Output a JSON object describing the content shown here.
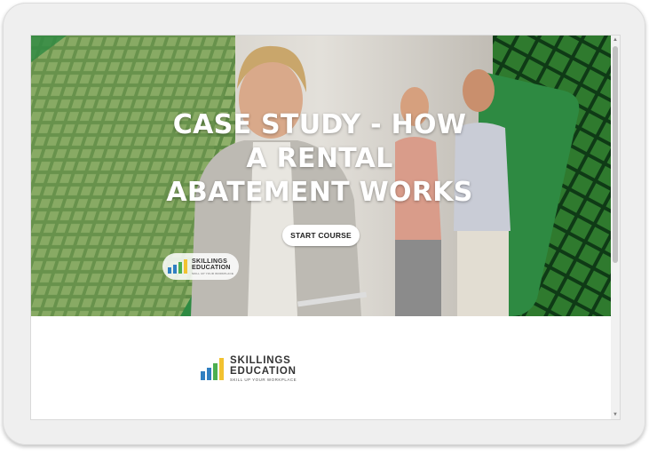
{
  "hero": {
    "title_line1": "CASE STUDY - HOW",
    "title_line2": "A RENTAL",
    "title_line3": "ABATEMENT WORKS",
    "start_button": "START COURSE",
    "badge": {
      "line1": "SKILLINGS",
      "line2": "EDUCATION",
      "tagline": "SKILL UP YOUR WORKPLACE"
    }
  },
  "footer": {
    "logo": {
      "line1": "SKILLINGS",
      "line2": "EDUCATION",
      "tagline": "SKILL UP YOUR WORKPLACE"
    }
  },
  "scroll": {
    "up_icon": "▲",
    "down_icon": "▼",
    "position_fraction": 0.0
  },
  "colors": {
    "brand_green": "#2e8a42",
    "dark_green": "#1f5e2a",
    "logo_bar_blue": "#2f7fc1",
    "logo_bar_green": "#4caf50",
    "logo_bar_yellow": "#f2c230"
  },
  "icons": {
    "logo": "bar-chart-logo-icon",
    "scroll_up": "chevron-up-icon",
    "scroll_down": "chevron-down-icon"
  }
}
